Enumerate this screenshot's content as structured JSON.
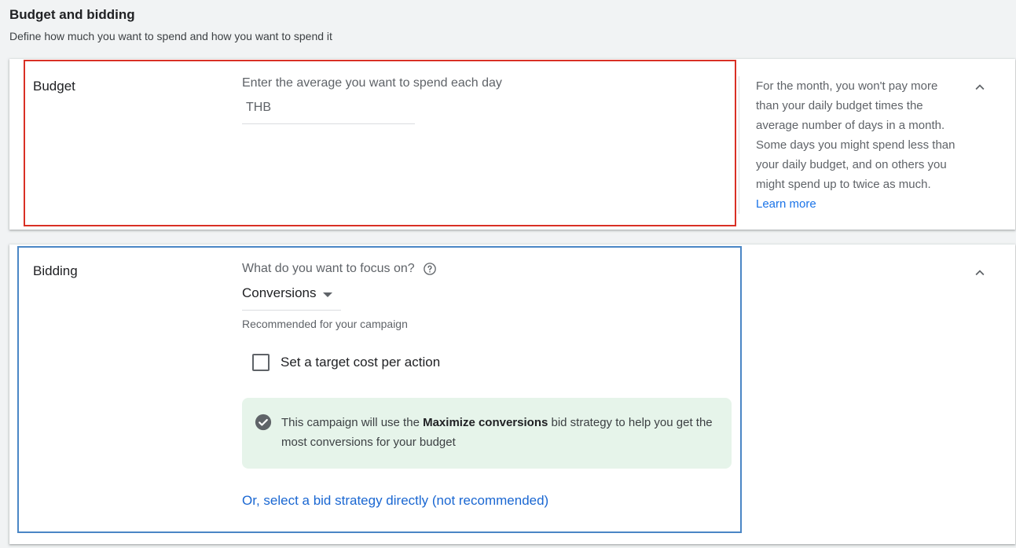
{
  "header": {
    "title": "Budget and bidding",
    "subtitle": "Define how much you want to spend and how you want to spend it"
  },
  "budget": {
    "label": "Budget",
    "field_label": "Enter the average you want to spend each day",
    "currency": "THB",
    "value": "",
    "help_text": "For the month, you won't pay more than your daily budget times the average number of days in a month. Some days you might spend less than your daily budget, and on others you might spend up to twice as much.",
    "learn_more": "Learn more"
  },
  "bidding": {
    "label": "Bidding",
    "focus_question": "What do you want to focus on?",
    "focus_value": "Conversions",
    "recommended": "Recommended for your campaign",
    "checkbox_label": "Set a target cost per action",
    "checkbox_checked": false,
    "info_prefix": "This campaign will use the ",
    "info_bold": "Maximize conversions",
    "info_suffix": " bid strategy to help you get the most conversions for your budget",
    "link": "Or, select a bid strategy directly (not recommended)"
  },
  "colors": {
    "highlight_red": "#d93025",
    "highlight_blue": "#4a86c5",
    "link_blue": "#1a73e8",
    "info_green_bg": "#e6f4ea"
  }
}
